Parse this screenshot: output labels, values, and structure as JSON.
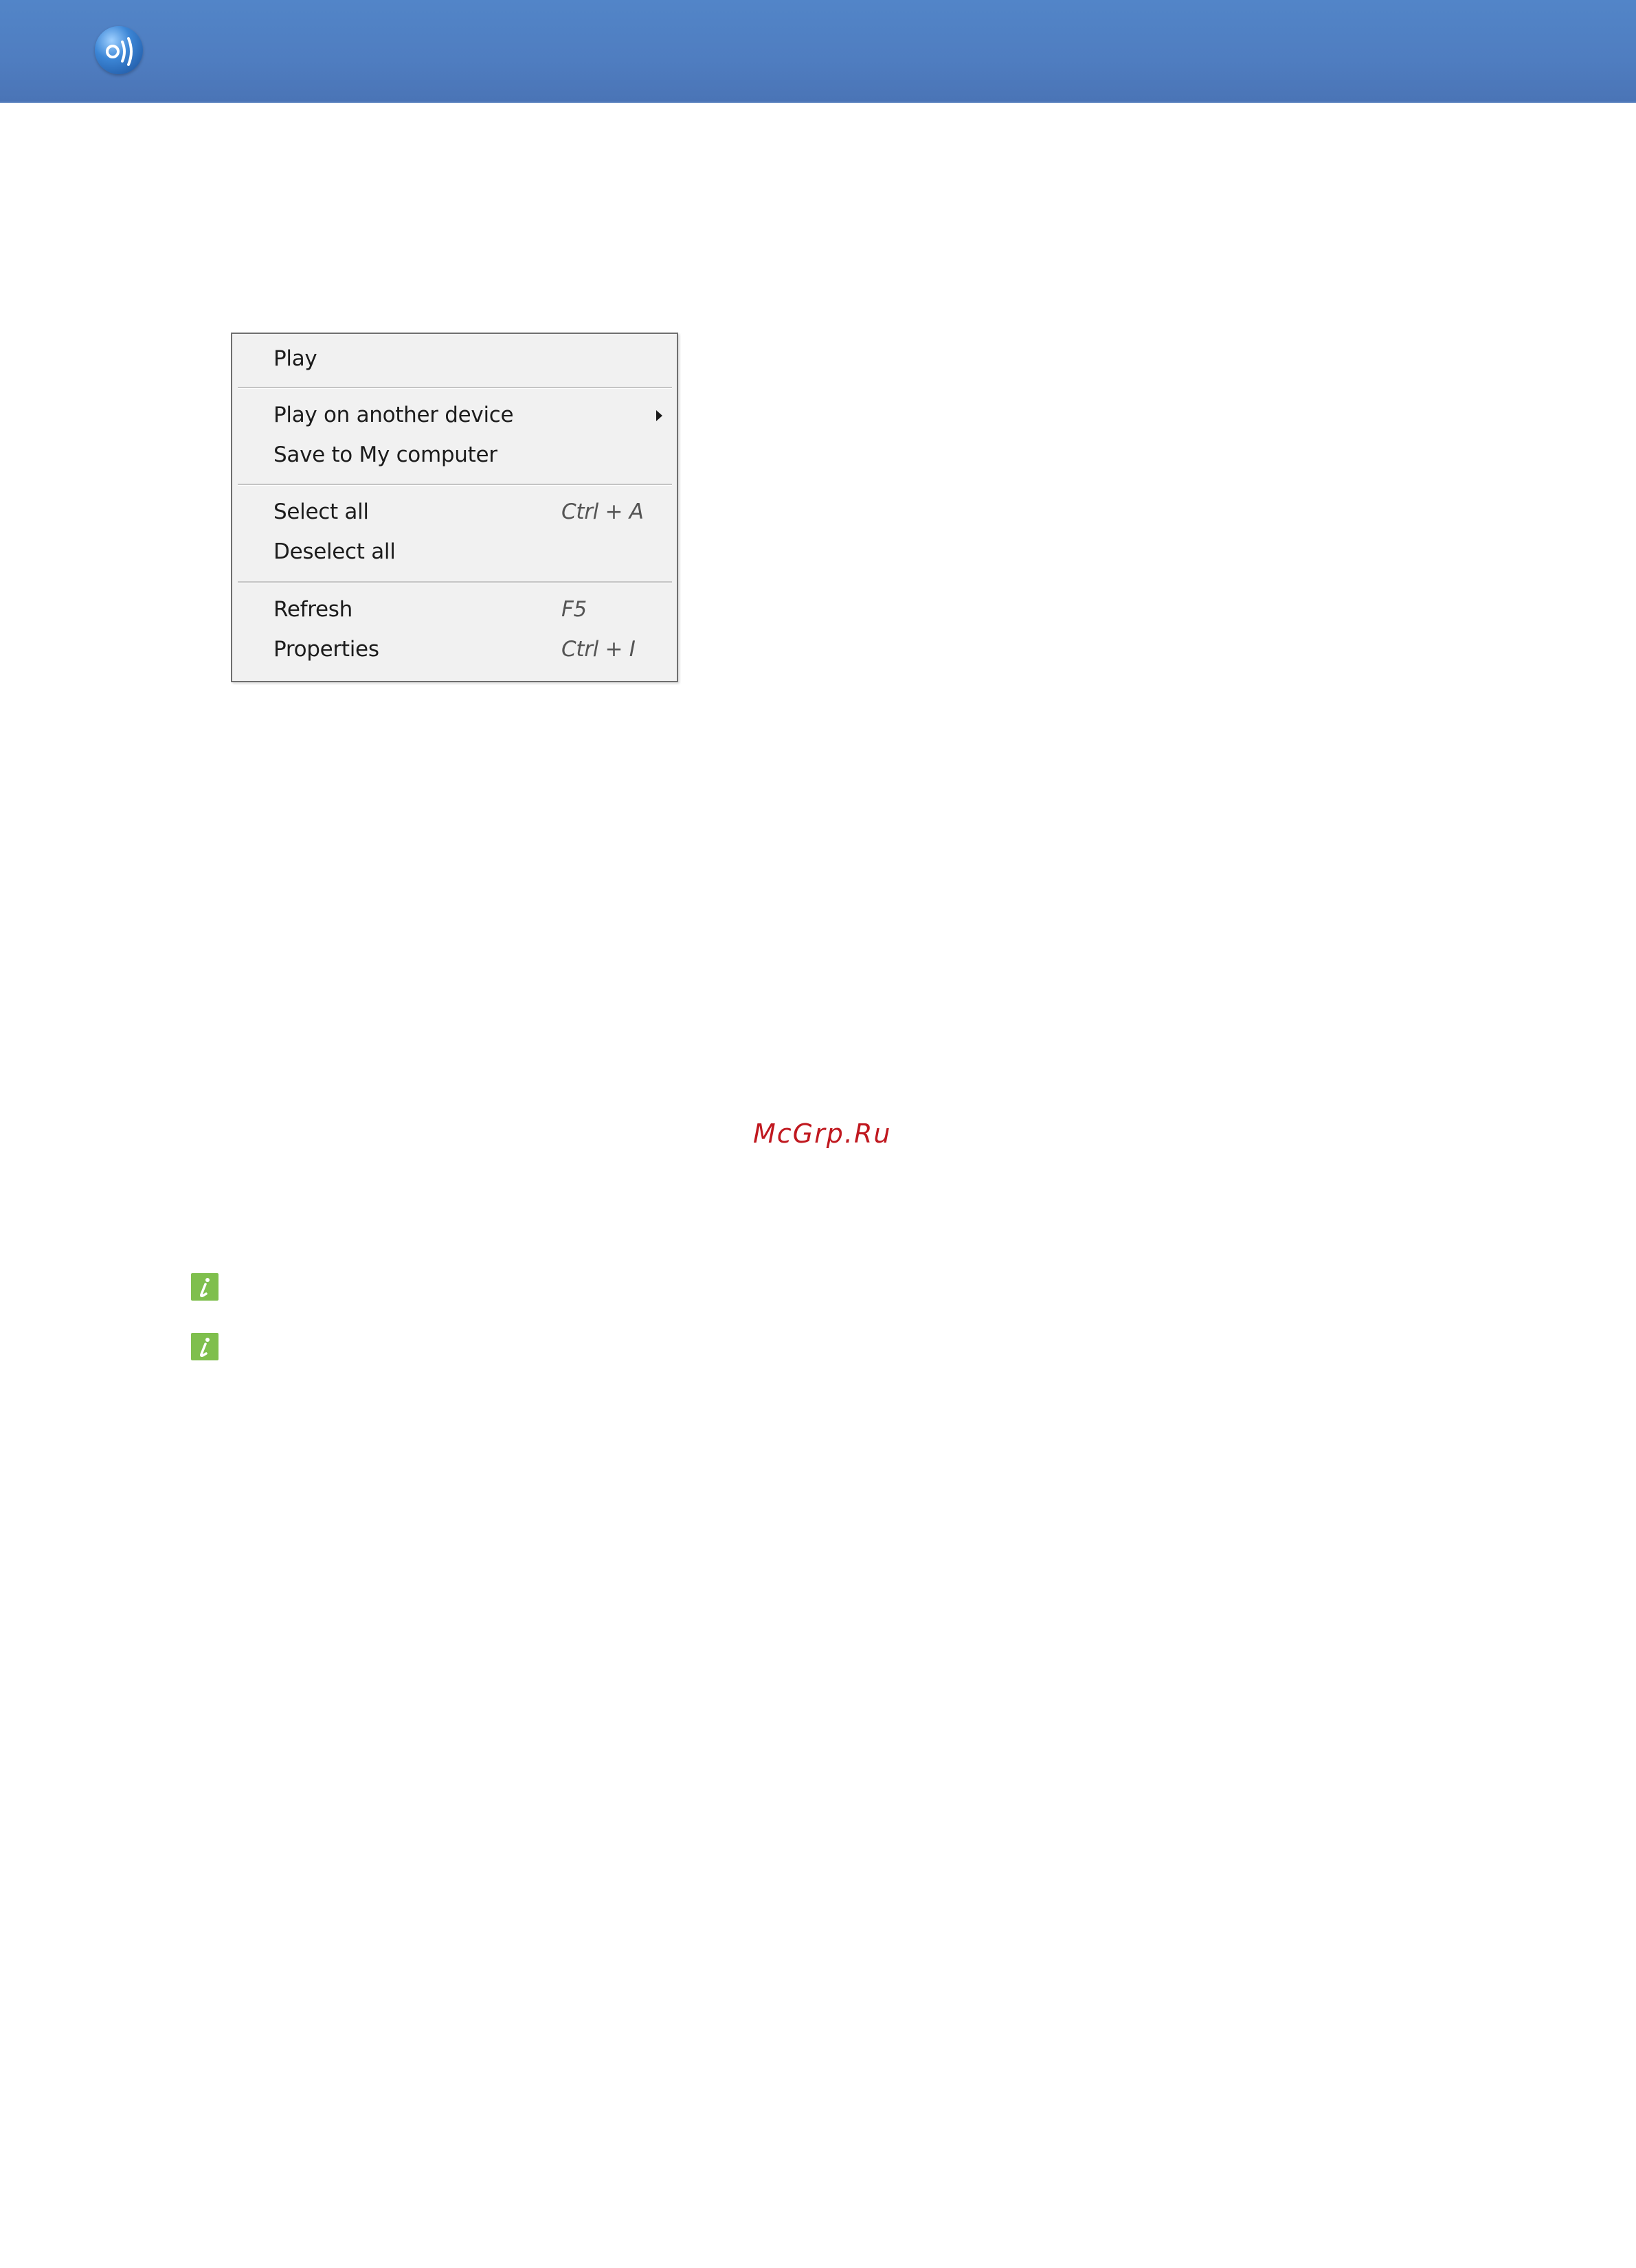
{
  "header": {
    "logo_icon": "allshare-logo-icon",
    "colors": {
      "bar": "#4f7dc0"
    }
  },
  "context_menu": {
    "items": [
      {
        "label": "Play",
        "shortcut": ""
      },
      {
        "label": "Play on another device",
        "shortcut": "",
        "submenu": true
      },
      {
        "label": "Save to My computer",
        "shortcut": ""
      },
      {
        "label": "Select all",
        "shortcut": "Ctrl + A"
      },
      {
        "label": "Deselect all",
        "shortcut": ""
      },
      {
        "label": "Refresh",
        "shortcut": "F5"
      },
      {
        "label": "Properties",
        "shortcut": "Ctrl + I"
      }
    ]
  },
  "watermark": {
    "text": "McGrp.Ru",
    "color": "#c0181f"
  },
  "notes": {
    "icon": "info-note-icon",
    "color": "#7fbf4d"
  }
}
